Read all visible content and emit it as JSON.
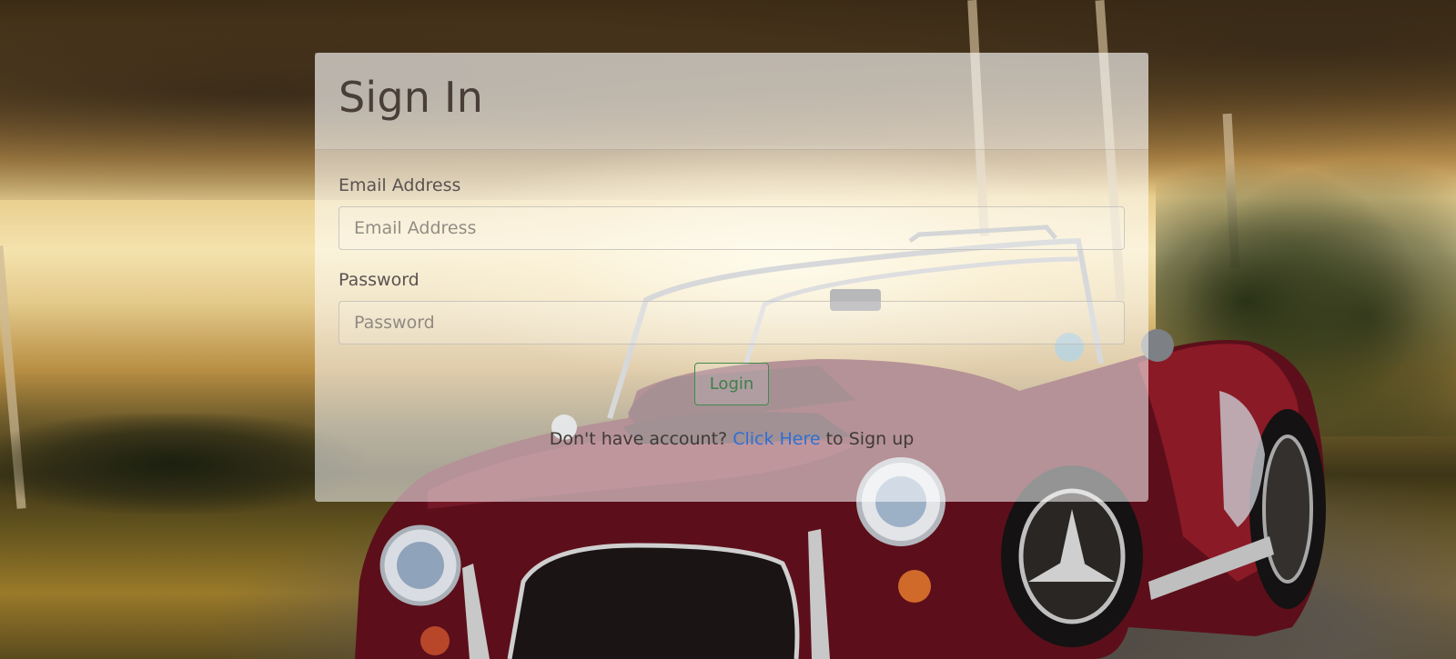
{
  "page": {
    "background_scene": "car-photo",
    "accent_colors": {
      "login_button": "#3d7f49",
      "link": "#2f6fd4",
      "title_text": "#4a3f38"
    }
  },
  "signin": {
    "title": "Sign In",
    "email": {
      "label": "Email Address",
      "placeholder": "Email Address",
      "value": ""
    },
    "password": {
      "label": "Password",
      "placeholder": "Password",
      "value": ""
    },
    "login_button_label": "Login",
    "signup_prompt_before": "Don't have account?",
    "signup_link_label": "Click Here",
    "signup_prompt_after": "to Sign up"
  }
}
